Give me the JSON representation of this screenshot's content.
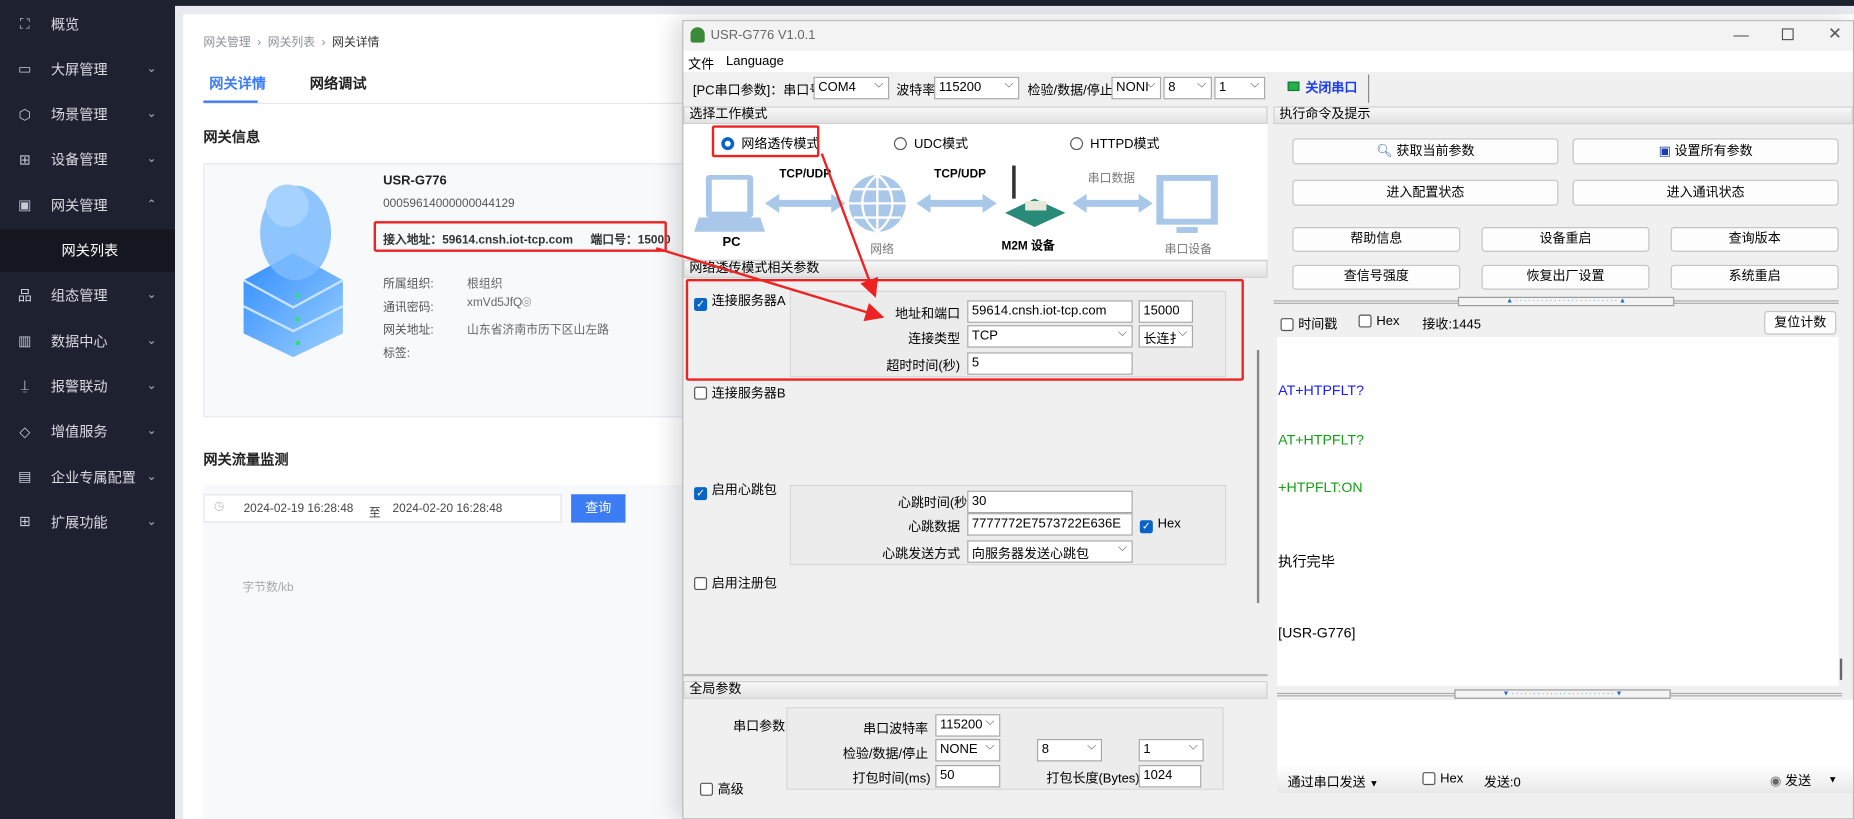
{
  "sidebar": {
    "items": [
      {
        "label": "概览",
        "icon": "scan-icon",
        "chev": ""
      },
      {
        "label": "大屏管理",
        "icon": "monitor-chart-icon",
        "chev": "⌄"
      },
      {
        "label": "场景管理",
        "icon": "hexagon-icon",
        "chev": "⌄"
      },
      {
        "label": "设备管理",
        "icon": "device-grid-icon",
        "chev": "⌄"
      },
      {
        "label": "网关管理",
        "icon": "gateway-chart-icon",
        "chev": "⌃"
      },
      {
        "label": "网关列表",
        "icon": "",
        "chev": "",
        "sub": true
      },
      {
        "label": "组态管理",
        "icon": "hierarchy-icon",
        "chev": "⌄"
      },
      {
        "label": "数据中心",
        "icon": "bar-chart-icon",
        "chev": "⌄"
      },
      {
        "label": "报警联动",
        "icon": "alarm-icon",
        "chev": "⌄"
      },
      {
        "label": "增值服务",
        "icon": "diamond-icon",
        "chev": "⌄"
      },
      {
        "label": "企业专属配置",
        "icon": "building-icon",
        "chev": "⌄"
      },
      {
        "label": "扩展功能",
        "icon": "apps-icon",
        "chev": "⌄"
      }
    ]
  },
  "breadcrumb": [
    "网关管理",
    "网关列表",
    "网关详情"
  ],
  "tabs": [
    "网关详情",
    "网络调试"
  ],
  "gateway": {
    "section_title": "网关信息",
    "name": "USR-G776",
    "id": "00059614000000044129",
    "access_label": "接入地址：",
    "access_value": "59614.cnsh.iot-tcp.com",
    "port_label": "端口号：",
    "port_value": "15000",
    "fields": [
      {
        "label": "所属组织:",
        "value": "根组织"
      },
      {
        "label": "通讯密码:",
        "value": "xmVd5JfQ"
      },
      {
        "label": "网关地址:",
        "value": "山东省济南市历下区山左路"
      },
      {
        "label": "标签:",
        "value": ""
      }
    ]
  },
  "traffic": {
    "title": "网关流量监测",
    "start": "2024-02-19 16:28:48",
    "to": "至",
    "end": "2024-02-20 16:28:48",
    "query": "查询",
    "y_label": "字节数/kb"
  },
  "tool": {
    "title": "USR-G776 V1.0.1",
    "menu": [
      "文件",
      "Language"
    ],
    "serial": {
      "label": "[PC串口参数]：串口号",
      "port": "COM4",
      "baud_label": "波特率",
      "baud": "115200",
      "parity_label": "检验/数据/停止",
      "parity": "NONI",
      "data": "8",
      "stop": "1",
      "close": "关闭串口",
      "status_color": "#22b14c"
    },
    "mode_title": "选择工作模式",
    "modes": [
      {
        "label": "网络透传模式",
        "selected": true
      },
      {
        "label": "UDC模式",
        "selected": false
      },
      {
        "label": "HTTPD模式",
        "selected": false
      }
    ],
    "diagram": {
      "pc": "PC",
      "link1": "TCP/UDP",
      "net": "网络",
      "link2": "TCP/UDP",
      "m2m": "M2M 设备",
      "link3": "串口数据",
      "serial_dev": "串口设备"
    },
    "params_title": "网络透传模式相关参数",
    "serverA": {
      "label": "连接服务器A",
      "checked": true,
      "addr_label": "地址和端口",
      "addr": "59614.cnsh.iot-tcp.com",
      "port": "15000",
      "type_label": "连接类型",
      "type": "TCP",
      "conn": "长连扌",
      "timeout_label": "超时时间(秒)",
      "timeout": "5"
    },
    "serverB": {
      "label": "连接服务器B",
      "checked": false
    },
    "heartbeat": {
      "label": "启用心跳包",
      "checked": true,
      "time_label": "心跳时间(秒",
      "time": "30",
      "data_label": "心跳数据",
      "data": "7777772E7573722E636E",
      "hex": "Hex",
      "hex_checked": true,
      "mode_label": "心跳发送方式",
      "mode": "向服务器发送心跳包"
    },
    "register": {
      "label": "启用注册包",
      "checked": false
    },
    "global_title": "全局参数",
    "global": {
      "group_label": "串口参数",
      "baud_label": "串口波特率",
      "baud": "115200",
      "parity_label": "检验/数据/停止",
      "parity": "NONE",
      "data": "8",
      "stop": "1",
      "pack_time_label": "打包时间(ms)",
      "pack_time": "50",
      "pack_len_label": "打包长度(Bytes)",
      "pack_len": "1024",
      "advanced": "高级"
    },
    "cmd_title": "执行命令及提示",
    "buttons_top": [
      "获取当前参数",
      "设置所有参数",
      "进入配置状态",
      "进入通讯状态"
    ],
    "buttons_grid": [
      "帮助信息",
      "设备重启",
      "查询版本",
      "查信号强度",
      "恢复出厂设置",
      "系统重启"
    ],
    "recv": {
      "timestamp": "时间戳",
      "hex": "Hex",
      "count": "接收:1445",
      "reset": "复位计数"
    },
    "log": [
      {
        "text": "AT+HTPFLT?",
        "color": "#1a1aff"
      },
      {
        "text": "AT+HTPFLT?",
        "color": "#16a016"
      },
      {
        "text": "+HTPFLT:ON",
        "color": "#16a016"
      },
      {
        "text": "执行完毕",
        "color": "#000000"
      },
      {
        "text": "[USR-G776]",
        "color": "#000000"
      }
    ],
    "send": {
      "via": "通过串口发送",
      "hex": "Hex",
      "count": "发送:0",
      "send": "发送"
    }
  }
}
